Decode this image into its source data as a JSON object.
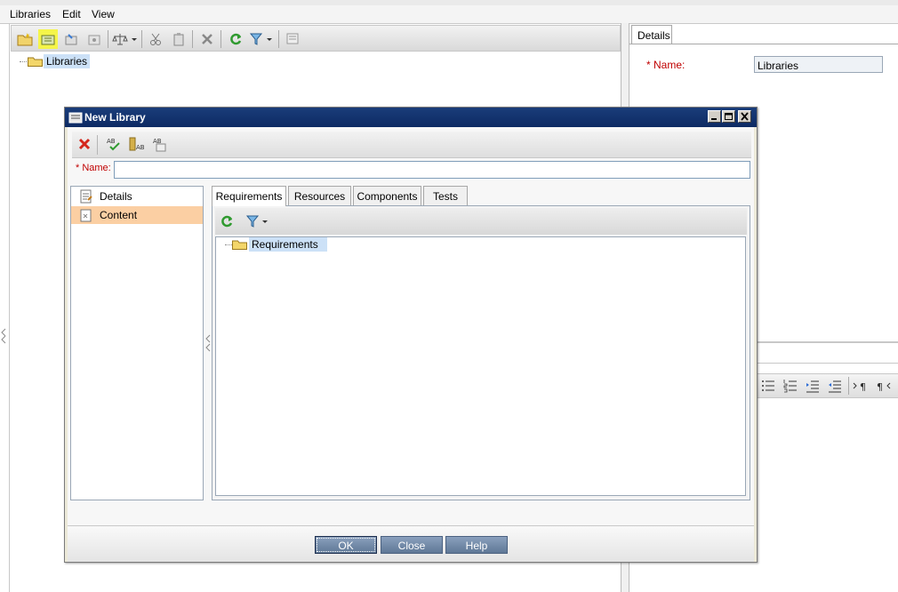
{
  "menubar": {
    "items": [
      "Libraries",
      "Edit",
      "View"
    ]
  },
  "main_tree": {
    "root_label": "Libraries"
  },
  "details_panel": {
    "tab_label": "Details",
    "name_label": "* Name:",
    "name_value": "Libraries"
  },
  "dialog": {
    "title": "New Library",
    "name_label": "* Name:",
    "name_value": "",
    "side_items": [
      {
        "label": "Details"
      },
      {
        "label": "Content"
      }
    ],
    "tabs": [
      {
        "label": "Requirements"
      },
      {
        "label": "Resources"
      },
      {
        "label": "Components"
      },
      {
        "label": "Tests"
      }
    ],
    "tree_root_label": "Requirements",
    "buttons": {
      "ok": "OK",
      "close": "Close",
      "help": "Help"
    }
  },
  "colors": {
    "title_bar": "#0d2a63",
    "selection": "#cce1f7",
    "content_highlight": "#fbcfa3",
    "required_label": "#c00000"
  }
}
